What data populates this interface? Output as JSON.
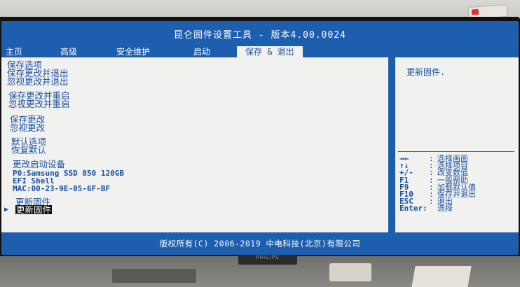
{
  "title": "昆仑固件设置工具 - 版本4.00.0024",
  "tabs": [
    {
      "label": "主页"
    },
    {
      "label": "高级"
    },
    {
      "label": "安全维护"
    },
    {
      "label": "启动"
    },
    {
      "label": "保存 & 退出"
    }
  ],
  "menu": {
    "save_options_header": "保存选项",
    "save_and_exit": "保存更改并退出",
    "discard_and_exit": "忽视更改并退出",
    "save_and_restart": "保存更改并重启",
    "discard_and_restart": "忽视更改并重启",
    "save_changes": "保存更改",
    "discard_changes": "忽视更改",
    "default_options_header": "默认选项",
    "restore_defaults": "恢复默认",
    "boot_override_header": "更改启动设备",
    "boot_device_1": "P0:Samsung SSD 850 120GB",
    "boot_device_2": "EFI Shell",
    "boot_device_3": "MAC:00-23-9E-05-6F-BF",
    "update_firmware_header": "更新固件",
    "update_firmware": "更新固件",
    "cursor_glyph": "▶"
  },
  "help": {
    "description": "更新固件.",
    "keys": [
      {
        "key": "→←",
        "sep": ":",
        "desc": "选择画面"
      },
      {
        "key": "↑↓",
        "sep": ":",
        "desc": "选择项目"
      },
      {
        "key": "+/-",
        "sep": ":",
        "desc": "改变数值"
      },
      {
        "key": "F1",
        "sep": ":",
        "desc": "一般帮助"
      },
      {
        "key": "F9",
        "sep": ":",
        "desc": "加载默认值"
      },
      {
        "key": "F10",
        "sep": ":",
        "desc": "保存并退出"
      },
      {
        "key": "ESC",
        "sep": ":",
        "desc": "退出"
      },
      {
        "key": "Enter:",
        "sep": "",
        "desc": "选择"
      }
    ]
  },
  "footer": "版权所有(C) 2006-2019 中电科技(北京)有限公司",
  "monitor_brand": "PHILIPS",
  "colors": {
    "screen_blue": "#1d5eae",
    "pane_bg": "#f1f2ef",
    "text_blue": "#1c4fa0",
    "selected_bg": "#101010"
  }
}
